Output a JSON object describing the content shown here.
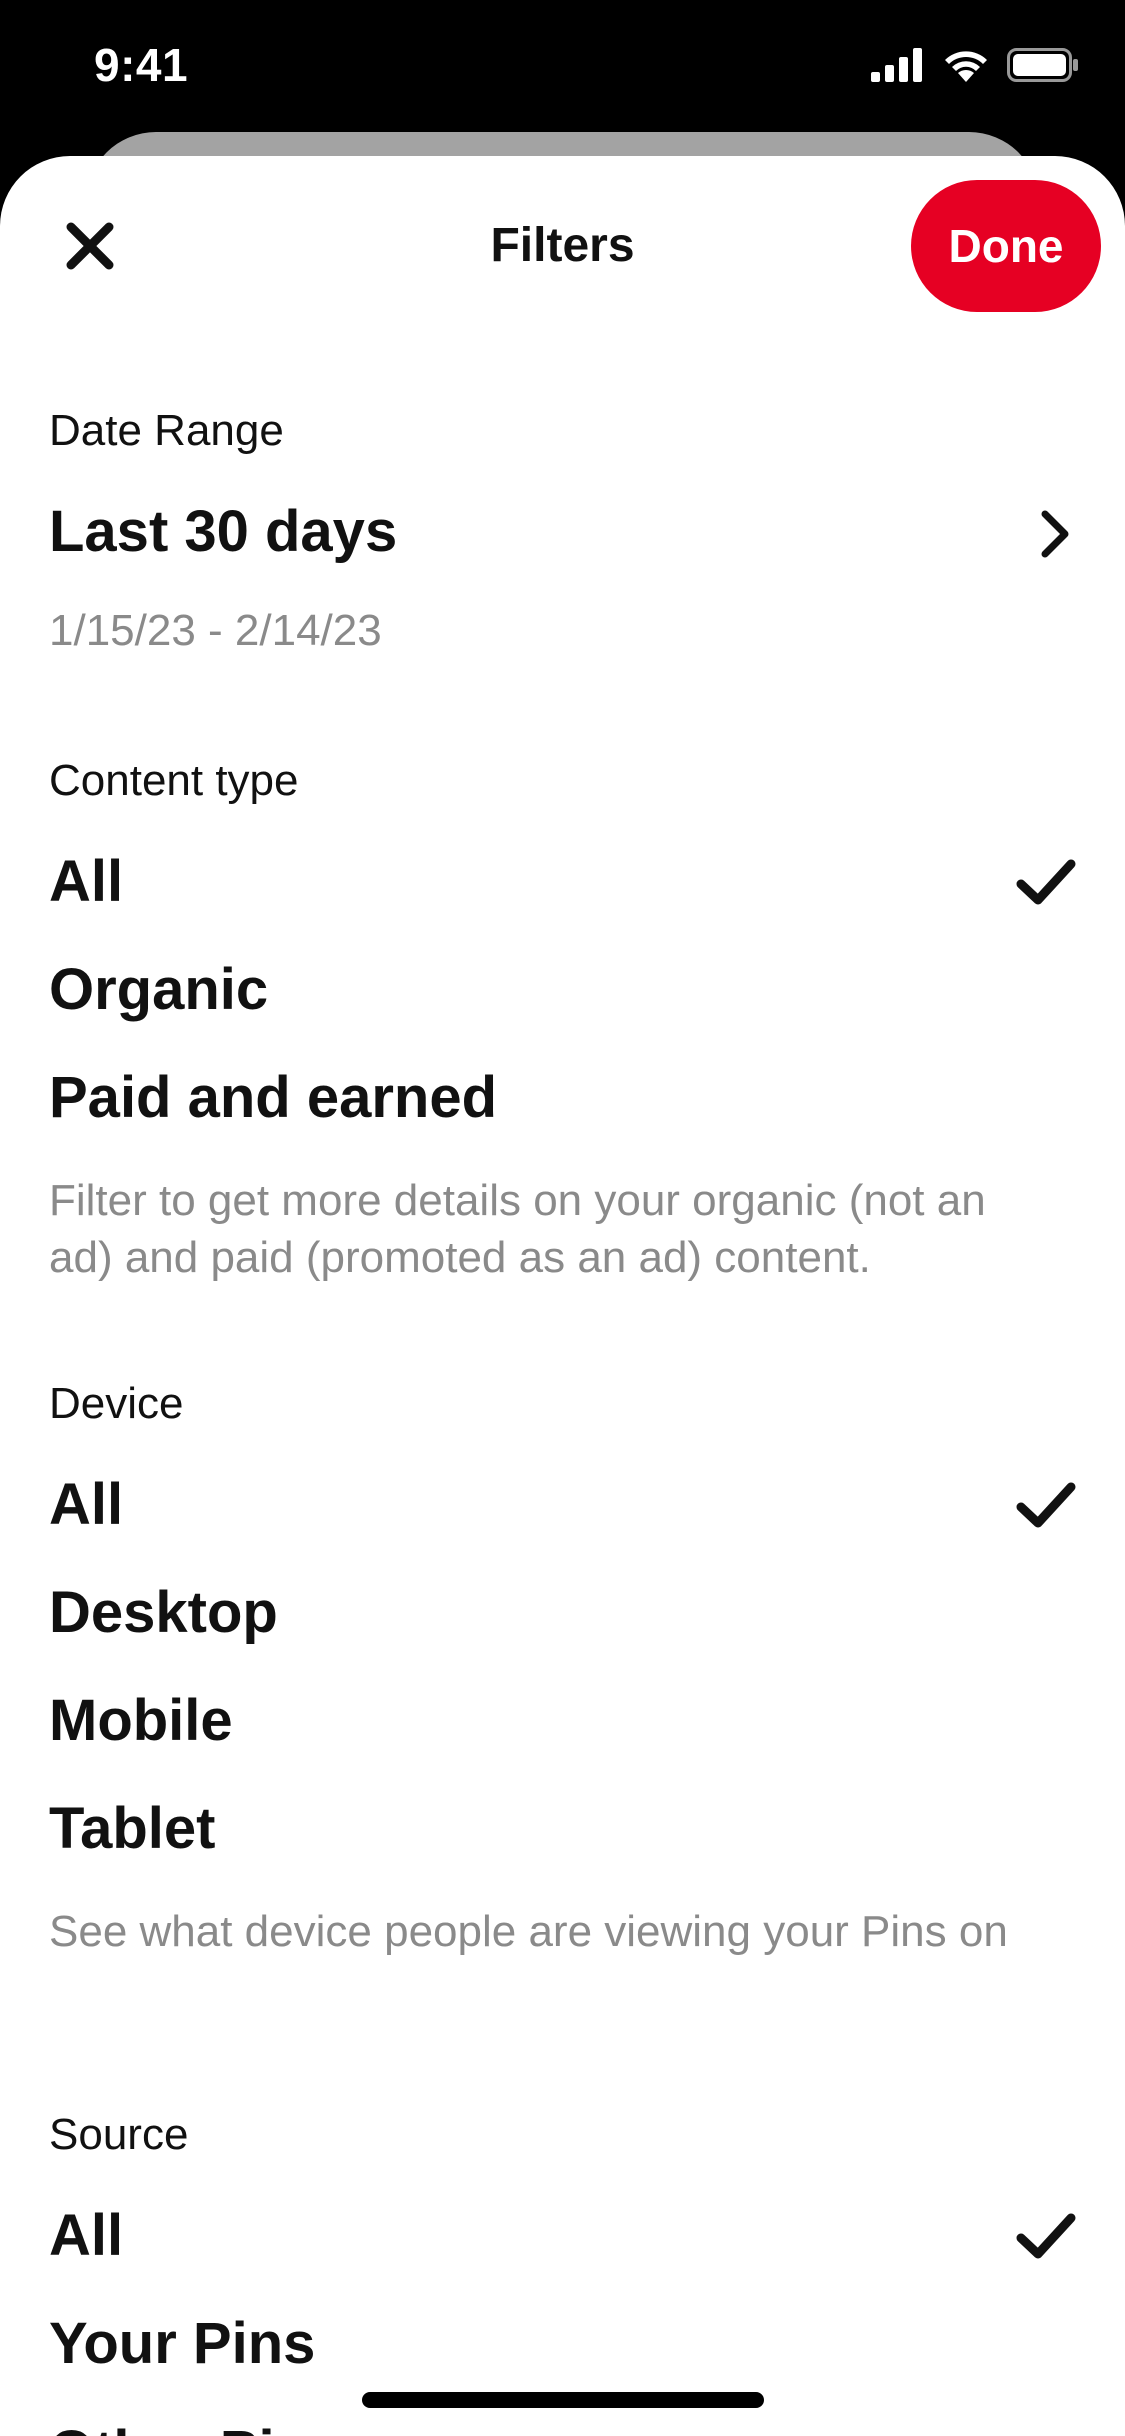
{
  "status_bar": {
    "time": "9:41",
    "icons": [
      "cellular-signal-icon",
      "wifi-icon",
      "battery-icon"
    ]
  },
  "header": {
    "title": "Filters",
    "close_icon": "close-icon",
    "done_label": "Done"
  },
  "colors": {
    "accent": "#e60023",
    "muted_text": "#8a8a8a",
    "background_card": "#a3a3a3"
  },
  "date_range": {
    "label": "Date Range",
    "value": "Last 30 days",
    "dates": "1/15/23 - 2/14/23"
  },
  "content_type": {
    "label": "Content type",
    "options": [
      {
        "label": "All",
        "selected": true
      },
      {
        "label": "Organic",
        "selected": false
      },
      {
        "label": "Paid and earned",
        "selected": false
      }
    ],
    "description": "Filter to get more details on your organic (not an ad) and paid (promoted as an ad) content."
  },
  "device": {
    "label": "Device",
    "options": [
      {
        "label": "All",
        "selected": true
      },
      {
        "label": "Desktop",
        "selected": false
      },
      {
        "label": "Mobile",
        "selected": false
      },
      {
        "label": "Tablet",
        "selected": false
      }
    ],
    "description": "See what device people are viewing your Pins on"
  },
  "source": {
    "label": "Source",
    "options": [
      {
        "label": "All",
        "selected": true
      },
      {
        "label": "Your Pins",
        "selected": false
      },
      {
        "label": "Other Pins",
        "selected": false
      }
    ]
  }
}
